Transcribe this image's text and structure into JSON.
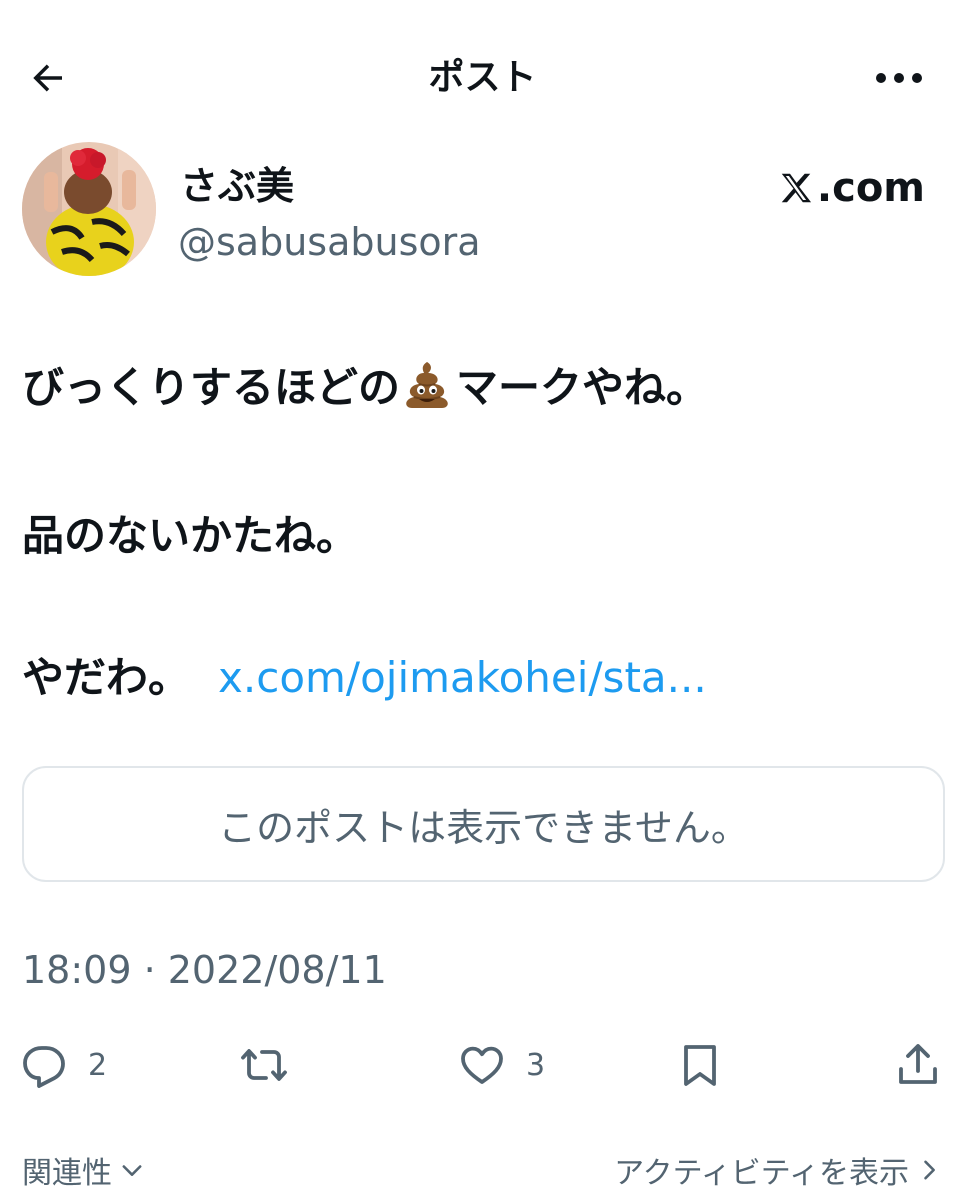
{
  "header": {
    "title": "ポスト",
    "back_icon": "arrow-left-icon",
    "more_icon": "more-horizontal-icon"
  },
  "author": {
    "display_name": "さぶ美",
    "handle": "@sabusabusora",
    "source": ".com"
  },
  "post": {
    "line1_before": "びっくりするほどの",
    "line1_emoji": "pile-of-poo-icon",
    "line1_after": "マークやね。",
    "line2": "品のないかたね。",
    "line3": "やだわ。",
    "link": "x.com/ojimakohei/sta..."
  },
  "quote": {
    "text": "このポストは表示できません。"
  },
  "timestamp": "18:09 · 2022/08/11",
  "actions": {
    "reply_count": "2",
    "like_count": "3"
  },
  "footer": {
    "related": "関連性",
    "activity": "アクティビティを表示"
  },
  "colors": {
    "text": "#0f1419",
    "secondary": "#536471",
    "link": "#1d9bf0",
    "border": "#e1e6ea"
  }
}
